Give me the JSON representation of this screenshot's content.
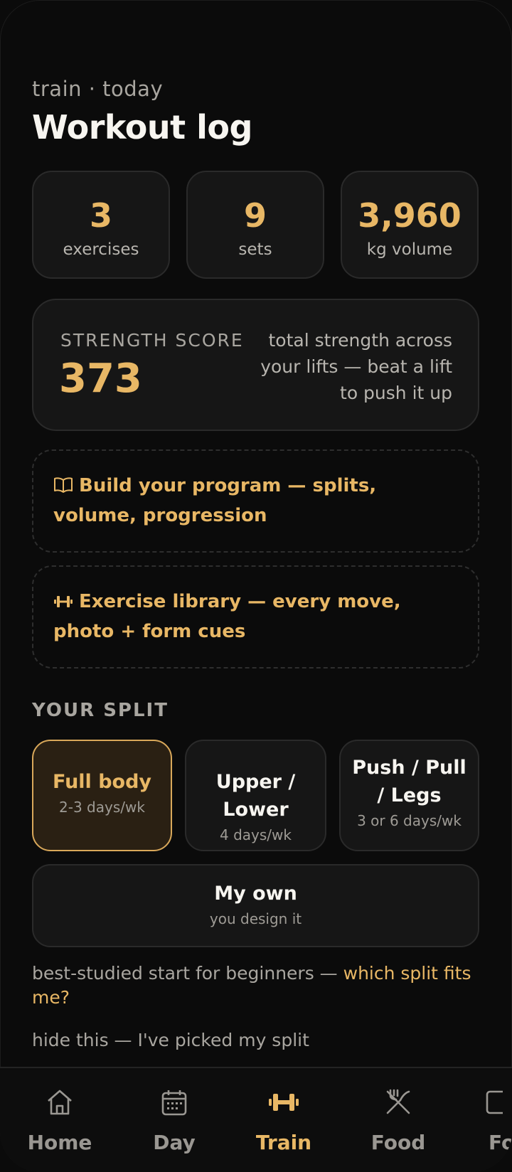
{
  "header": {
    "eyebrow": "train · today",
    "title": "Workout log"
  },
  "stats": [
    {
      "value": "3",
      "label": "exercises"
    },
    {
      "value": "9",
      "label": "sets"
    },
    {
      "value": "3,960",
      "label": "kg volume"
    }
  ],
  "strength": {
    "label": "STRENGTH SCORE",
    "value": "373",
    "description": "total strength across your lifts — beat a lift to push it up"
  },
  "links": {
    "program": "Build your program — splits, volume, progression",
    "library": "Exercise library — every move, photo + form cues"
  },
  "split": {
    "heading": "YOUR SPLIT",
    "options": [
      {
        "name": "Full body",
        "sub": "2-3 days/wk",
        "selected": true
      },
      {
        "name": "Upper / Lower",
        "sub": "4 days/wk",
        "selected": false
      },
      {
        "name": "Push / Pull / Legs",
        "sub": "3 or 6 days/wk",
        "selected": false
      }
    ],
    "own": {
      "name": "My own",
      "sub": "you design it"
    },
    "hint_text": "best-studied start for beginners — ",
    "hint_link": "which split fits me?",
    "hide": "hide this — I've picked my split"
  },
  "nav": {
    "tabs": [
      {
        "label": "Home",
        "icon": "home-icon"
      },
      {
        "label": "Day",
        "icon": "calendar-icon"
      },
      {
        "label": "Train",
        "icon": "dumbbell-icon",
        "active": true
      },
      {
        "label": "Food",
        "icon": "utensils-icon"
      },
      {
        "label": "Fo",
        "icon": "food-icon"
      }
    ]
  },
  "colors": {
    "accent": "#e8b765",
    "background": "#0b0b0b",
    "card": "#161616"
  }
}
